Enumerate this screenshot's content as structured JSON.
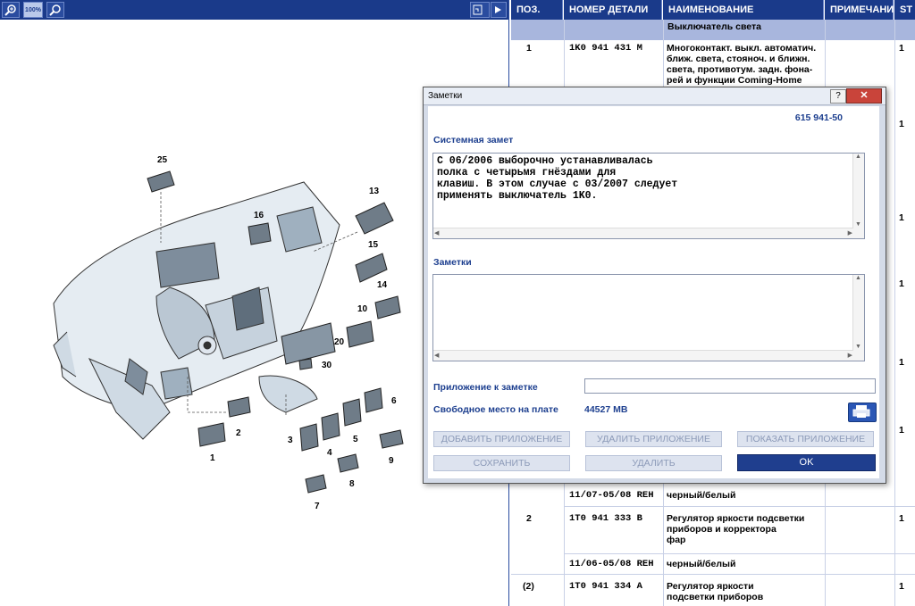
{
  "toolbar": {
    "zoom_in_icon": "magnify-plus-icon",
    "zoom_100_label": "100%",
    "search_icon": "magnify-icon",
    "right_icon": "export-icon"
  },
  "table": {
    "headers": [
      "ПОЗ.",
      "НОМЕР ДЕТАЛИ",
      "НАИМЕНОВАНИЕ",
      "ПРИМЕЧАНИЕ",
      "ST"
    ],
    "selected_name": "Выключатель света",
    "rows": [
      {
        "pos": "1",
        "part": "1K0 941 431 M",
        "name": "Многоконтакт. выкл. автоматич.\nближ. света, стояноч. и ближн.\nсвета, противотум. задн. фона-\nрей и функции Coming-Home",
        "st": "1"
      },
      {
        "pos": "",
        "part": "11/07-05/08 REH",
        "name": "черный/белый",
        "st": ""
      },
      {
        "pos": "2",
        "part": "1T0 941 333 B",
        "name": "Регулятор яркости подсветки\nприборов и корректора\nфар",
        "st": "1"
      },
      {
        "pos": "",
        "part": "11/06-05/08 REH",
        "name": "черный/белый",
        "st": ""
      },
      {
        "pos": "(2)",
        "part": "1T0 941 334 A",
        "name": "Регулятор яркости\nподсветки приборов",
        "st": "1"
      }
    ],
    "st_column_values": [
      "1",
      "1",
      "1",
      "1",
      "1",
      "1",
      "1",
      "1",
      "1"
    ]
  },
  "diagram": {
    "callouts": [
      "25",
      "13",
      "16",
      "15",
      "14",
      "10",
      "20",
      "30",
      "6",
      "5",
      "2",
      "1",
      "3",
      "4",
      "8",
      "7",
      "9"
    ]
  },
  "dialog": {
    "title": "Заметки",
    "help_label": "?",
    "close_label": "✕",
    "part_ref": "615 941-50",
    "system_note_label": "Системная замет",
    "system_note_text": "С 06/2006 выборочно устанавливалась\nполка с четырьмя гнёздами для\nклавиш. В этом случае с 03/2007 следует\nприменять выключатель 1K0.",
    "notes_label": "Заметки",
    "notes_value": "",
    "attachment_label": "Приложение к заметке",
    "attachment_value": "",
    "free_space_label": "Свободное место на плате",
    "free_space_value": "44527 MB",
    "buttons": {
      "add_attachment": "ДОБАВИТЬ ПРИЛОЖЕНИЕ",
      "delete_attachment": "УДАЛИТЬ ПРИЛОЖЕНИЕ",
      "show_attachment": "ПОКАЗАТЬ ПРИЛОЖЕНИЕ",
      "save": "СОХРАНИТЬ",
      "delete": "УДАЛИТЬ",
      "ok": "OK"
    }
  }
}
